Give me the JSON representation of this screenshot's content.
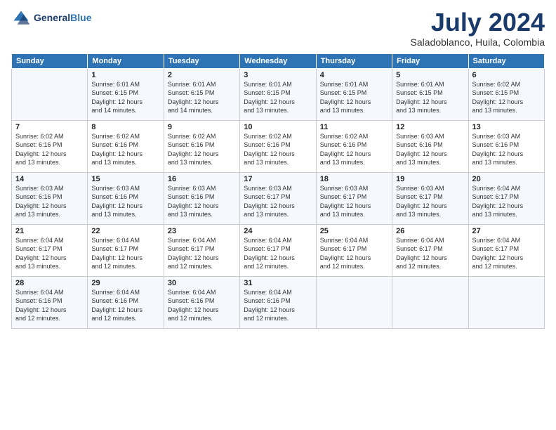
{
  "header": {
    "logo_line1": "General",
    "logo_line2": "Blue",
    "title": "July 2024",
    "subtitle": "Saladoblanco, Huila, Colombia"
  },
  "columns": [
    "Sunday",
    "Monday",
    "Tuesday",
    "Wednesday",
    "Thursday",
    "Friday",
    "Saturday"
  ],
  "weeks": [
    [
      {
        "day": "",
        "info": ""
      },
      {
        "day": "1",
        "info": "Sunrise: 6:01 AM\nSunset: 6:15 PM\nDaylight: 12 hours\nand 14 minutes."
      },
      {
        "day": "2",
        "info": "Sunrise: 6:01 AM\nSunset: 6:15 PM\nDaylight: 12 hours\nand 14 minutes."
      },
      {
        "day": "3",
        "info": "Sunrise: 6:01 AM\nSunset: 6:15 PM\nDaylight: 12 hours\nand 13 minutes."
      },
      {
        "day": "4",
        "info": "Sunrise: 6:01 AM\nSunset: 6:15 PM\nDaylight: 12 hours\nand 13 minutes."
      },
      {
        "day": "5",
        "info": "Sunrise: 6:01 AM\nSunset: 6:15 PM\nDaylight: 12 hours\nand 13 minutes."
      },
      {
        "day": "6",
        "info": "Sunrise: 6:02 AM\nSunset: 6:15 PM\nDaylight: 12 hours\nand 13 minutes."
      }
    ],
    [
      {
        "day": "7",
        "info": "Sunrise: 6:02 AM\nSunset: 6:16 PM\nDaylight: 12 hours\nand 13 minutes."
      },
      {
        "day": "8",
        "info": "Sunrise: 6:02 AM\nSunset: 6:16 PM\nDaylight: 12 hours\nand 13 minutes."
      },
      {
        "day": "9",
        "info": "Sunrise: 6:02 AM\nSunset: 6:16 PM\nDaylight: 12 hours\nand 13 minutes."
      },
      {
        "day": "10",
        "info": "Sunrise: 6:02 AM\nSunset: 6:16 PM\nDaylight: 12 hours\nand 13 minutes."
      },
      {
        "day": "11",
        "info": "Sunrise: 6:02 AM\nSunset: 6:16 PM\nDaylight: 12 hours\nand 13 minutes."
      },
      {
        "day": "12",
        "info": "Sunrise: 6:03 AM\nSunset: 6:16 PM\nDaylight: 12 hours\nand 13 minutes."
      },
      {
        "day": "13",
        "info": "Sunrise: 6:03 AM\nSunset: 6:16 PM\nDaylight: 12 hours\nand 13 minutes."
      }
    ],
    [
      {
        "day": "14",
        "info": "Sunrise: 6:03 AM\nSunset: 6:16 PM\nDaylight: 12 hours\nand 13 minutes."
      },
      {
        "day": "15",
        "info": "Sunrise: 6:03 AM\nSunset: 6:16 PM\nDaylight: 12 hours\nand 13 minutes."
      },
      {
        "day": "16",
        "info": "Sunrise: 6:03 AM\nSunset: 6:16 PM\nDaylight: 12 hours\nand 13 minutes."
      },
      {
        "day": "17",
        "info": "Sunrise: 6:03 AM\nSunset: 6:17 PM\nDaylight: 12 hours\nand 13 minutes."
      },
      {
        "day": "18",
        "info": "Sunrise: 6:03 AM\nSunset: 6:17 PM\nDaylight: 12 hours\nand 13 minutes."
      },
      {
        "day": "19",
        "info": "Sunrise: 6:03 AM\nSunset: 6:17 PM\nDaylight: 12 hours\nand 13 minutes."
      },
      {
        "day": "20",
        "info": "Sunrise: 6:04 AM\nSunset: 6:17 PM\nDaylight: 12 hours\nand 13 minutes."
      }
    ],
    [
      {
        "day": "21",
        "info": "Sunrise: 6:04 AM\nSunset: 6:17 PM\nDaylight: 12 hours\nand 13 minutes."
      },
      {
        "day": "22",
        "info": "Sunrise: 6:04 AM\nSunset: 6:17 PM\nDaylight: 12 hours\nand 12 minutes."
      },
      {
        "day": "23",
        "info": "Sunrise: 6:04 AM\nSunset: 6:17 PM\nDaylight: 12 hours\nand 12 minutes."
      },
      {
        "day": "24",
        "info": "Sunrise: 6:04 AM\nSunset: 6:17 PM\nDaylight: 12 hours\nand 12 minutes."
      },
      {
        "day": "25",
        "info": "Sunrise: 6:04 AM\nSunset: 6:17 PM\nDaylight: 12 hours\nand 12 minutes."
      },
      {
        "day": "26",
        "info": "Sunrise: 6:04 AM\nSunset: 6:17 PM\nDaylight: 12 hours\nand 12 minutes."
      },
      {
        "day": "27",
        "info": "Sunrise: 6:04 AM\nSunset: 6:17 PM\nDaylight: 12 hours\nand 12 minutes."
      }
    ],
    [
      {
        "day": "28",
        "info": "Sunrise: 6:04 AM\nSunset: 6:16 PM\nDaylight: 12 hours\nand 12 minutes."
      },
      {
        "day": "29",
        "info": "Sunrise: 6:04 AM\nSunset: 6:16 PM\nDaylight: 12 hours\nand 12 minutes."
      },
      {
        "day": "30",
        "info": "Sunrise: 6:04 AM\nSunset: 6:16 PM\nDaylight: 12 hours\nand 12 minutes."
      },
      {
        "day": "31",
        "info": "Sunrise: 6:04 AM\nSunset: 6:16 PM\nDaylight: 12 hours\nand 12 minutes."
      },
      {
        "day": "",
        "info": ""
      },
      {
        "day": "",
        "info": ""
      },
      {
        "day": "",
        "info": ""
      }
    ]
  ]
}
